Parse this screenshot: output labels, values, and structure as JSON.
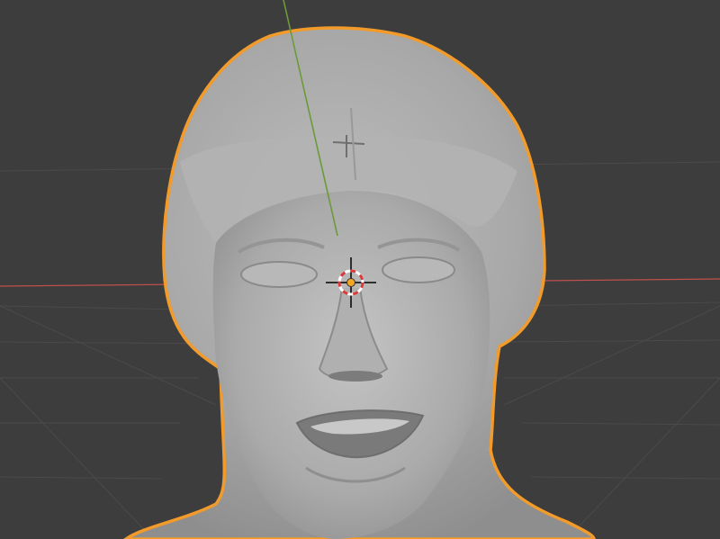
{
  "app": {
    "name": "3D viewport",
    "mode": "object"
  },
  "viewport": {
    "background_color": "#3d3d3d",
    "grid_visible": true,
    "grid_color": "#4a4a4a",
    "axes": {
      "x_axis_color": "#c0504d",
      "y_axis_color": "#6b9a3a"
    }
  },
  "selected_object": {
    "type": "sculpted head mesh",
    "selected": true,
    "outline_color": "#f29b2b",
    "mesh_color": "#a6a6a6"
  },
  "cursor_3d": {
    "ring_colors": [
      "#d93b3b",
      "#ffffff"
    ],
    "origin_color": "#f5a623"
  }
}
